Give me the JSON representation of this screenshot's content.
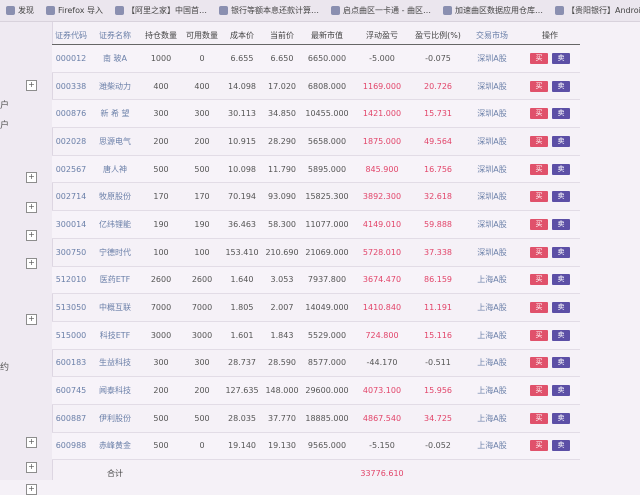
{
  "bookmarks": [
    {
      "label": "发现",
      "icon": "star-icon"
    },
    {
      "label": "Firefox 导入",
      "icon": "firefox-icon"
    },
    {
      "label": "【阿里之家】中国首…",
      "icon": "page-icon"
    },
    {
      "label": "银行等额本息还款计算…",
      "icon": "bank-icon"
    },
    {
      "label": "启点曲区一卡通 - 曲区…",
      "icon": "page-icon"
    },
    {
      "label": "加速曲区数据应用仓库…",
      "icon": "page-icon"
    },
    {
      "label": "【贵阳银行】Android…",
      "icon": "page-icon"
    }
  ],
  "sidebar": {
    "texts": [
      "户",
      "户",
      "约"
    ]
  },
  "table": {
    "headers": [
      "证券代码",
      "证券名称",
      "持仓数量",
      "可用数量",
      "成本价",
      "当前价",
      "最新市值",
      "浮动盈亏",
      "盈亏比例(%)",
      "交易市场",
      "操作"
    ],
    "rows": [
      {
        "code": "000012",
        "name": "南 玻A",
        "qty": "1000",
        "avail": "0",
        "cost": "6.655",
        "price": "6.650",
        "mv": "6650.000",
        "pnl": "-5.000",
        "pct": "-0.075",
        "market": "深圳A股"
      },
      {
        "code": "000338",
        "name": "潍柴动力",
        "qty": "400",
        "avail": "400",
        "cost": "14.098",
        "price": "17.020",
        "mv": "6808.000",
        "pnl": "1169.000",
        "pct": "20.726",
        "market": "深圳A股"
      },
      {
        "code": "000876",
        "name": "新 希 望",
        "qty": "300",
        "avail": "300",
        "cost": "30.113",
        "price": "34.850",
        "mv": "10455.000",
        "pnl": "1421.000",
        "pct": "15.731",
        "market": "深圳A股"
      },
      {
        "code": "002028",
        "name": "思源电气",
        "qty": "200",
        "avail": "200",
        "cost": "10.915",
        "price": "28.290",
        "mv": "5658.000",
        "pnl": "1875.000",
        "pct": "49.564",
        "market": "深圳A股"
      },
      {
        "code": "002567",
        "name": "唐人神",
        "qty": "500",
        "avail": "500",
        "cost": "10.098",
        "price": "11.790",
        "mv": "5895.000",
        "pnl": "845.900",
        "pct": "16.756",
        "market": "深圳A股"
      },
      {
        "code": "002714",
        "name": "牧原股份",
        "qty": "170",
        "avail": "170",
        "cost": "70.194",
        "price": "93.090",
        "mv": "15825.300",
        "pnl": "3892.300",
        "pct": "32.618",
        "market": "深圳A股"
      },
      {
        "code": "300014",
        "name": "亿纬锂能",
        "qty": "190",
        "avail": "190",
        "cost": "36.463",
        "price": "58.300",
        "mv": "11077.000",
        "pnl": "4149.010",
        "pct": "59.888",
        "market": "深圳A股"
      },
      {
        "code": "300750",
        "name": "宁德时代",
        "qty": "100",
        "avail": "100",
        "cost": "153.410",
        "price": "210.690",
        "mv": "21069.000",
        "pnl": "5728.010",
        "pct": "37.338",
        "market": "深圳A股"
      },
      {
        "code": "512010",
        "name": "医药ETF",
        "qty": "2600",
        "avail": "2600",
        "cost": "1.640",
        "price": "3.053",
        "mv": "7937.800",
        "pnl": "3674.470",
        "pct": "86.159",
        "market": "上海A股"
      },
      {
        "code": "513050",
        "name": "中概互联",
        "qty": "7000",
        "avail": "7000",
        "cost": "1.805",
        "price": "2.007",
        "mv": "14049.000",
        "pnl": "1410.840",
        "pct": "11.191",
        "market": "上海A股"
      },
      {
        "code": "515000",
        "name": "科技ETF",
        "qty": "3000",
        "avail": "3000",
        "cost": "1.601",
        "price": "1.843",
        "mv": "5529.000",
        "pnl": "724.800",
        "pct": "15.116",
        "market": "上海A股"
      },
      {
        "code": "600183",
        "name": "生益科技",
        "qty": "300",
        "avail": "300",
        "cost": "28.737",
        "price": "28.590",
        "mv": "8577.000",
        "pnl": "-44.170",
        "pct": "-0.511",
        "market": "上海A股"
      },
      {
        "code": "600745",
        "name": "闻泰科技",
        "qty": "200",
        "avail": "200",
        "cost": "127.635",
        "price": "148.000",
        "mv": "29600.000",
        "pnl": "4073.100",
        "pct": "15.956",
        "market": "上海A股"
      },
      {
        "code": "600887",
        "name": "伊利股份",
        "qty": "500",
        "avail": "500",
        "cost": "28.035",
        "price": "37.770",
        "mv": "18885.000",
        "pnl": "4867.540",
        "pct": "34.725",
        "market": "上海A股"
      },
      {
        "code": "600988",
        "name": "赤峰黄金",
        "qty": "500",
        "avail": "0",
        "cost": "19.140",
        "price": "19.130",
        "mv": "9565.000",
        "pnl": "-5.150",
        "pct": "-0.052",
        "market": "上海A股"
      }
    ],
    "buy_label": "买",
    "sell_label": "卖",
    "total_label": "合计",
    "total_pnl": "33776.610"
  },
  "colors": {
    "positive": "#e2456a",
    "buy_button": "#e0516b",
    "sell_button": "#5c4fa6",
    "link": "#6a7fa8"
  }
}
